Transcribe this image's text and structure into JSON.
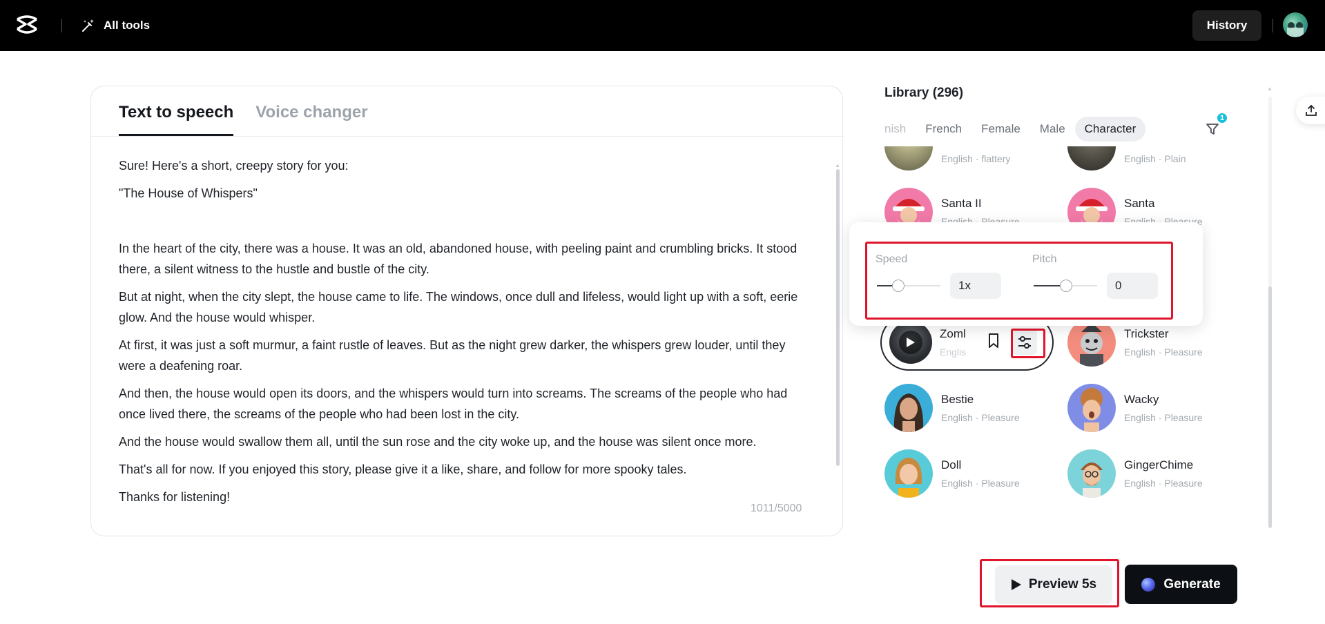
{
  "topbar": {
    "all_tools_label": "All tools",
    "history_label": "History"
  },
  "editor": {
    "tabs": [
      {
        "label": "Text to speech",
        "active": true
      },
      {
        "label": "Voice changer",
        "active": false
      }
    ],
    "paragraphs": [
      "Sure! Here's a short, creepy story for you:",
      "\"The House of Whispers\"",
      "",
      "In the heart of the city, there was a house. It was an old, abandoned house, with peeling paint and crumbling bricks. It stood there, a silent witness to the hustle and bustle of the city.",
      "But at night, when the city slept, the house came to life. The windows, once dull and lifeless, would light up with a soft, eerie glow. And the house would whisper.",
      "At first, it was just a soft murmur, a faint rustle of leaves. But as the night grew darker, the whispers grew louder, until they were a deafening roar.",
      "And then, the house would open its doors, and the whispers would turn into screams. The screams of the people who had once lived there, the screams of the people who had been lost in the city.",
      "And the house would swallow them all, until the sun rose and the city woke up, and the house was silent once more.",
      "That's all for now. If you enjoyed this story, please give it a like, share, and follow for more spooky tales.",
      "Thanks for listening!"
    ],
    "char_count": "1011/5000"
  },
  "library": {
    "title": "Library (296)",
    "filters": [
      {
        "label": "nish",
        "active": false
      },
      {
        "label": "French",
        "active": false
      },
      {
        "label": "Female",
        "active": false
      },
      {
        "label": "Male",
        "active": false
      },
      {
        "label": "Character",
        "active": true
      }
    ],
    "filter_badge": "1",
    "top_partial": [
      {
        "meta": "English · flattery"
      },
      {
        "meta": "English · Plain"
      }
    ],
    "voices": [
      {
        "name": "Santa II",
        "meta": "English · Pleasure"
      },
      {
        "name": "Santa",
        "meta": "English · Pleasure"
      },
      {
        "name": "Zombie",
        "meta": "English · Pleasure"
      },
      {
        "name": "Trickster",
        "meta": "English · Pleasure"
      },
      {
        "name": "Bestie",
        "meta": "English · Pleasure"
      },
      {
        "name": "Wacky",
        "meta": "English · Pleasure"
      },
      {
        "name": "Doll",
        "meta": "English · Pleasure"
      },
      {
        "name": "GingerChime",
        "meta": "English · Pleasure"
      }
    ],
    "selected_name": "Zoml",
    "selected_meta": "Englis"
  },
  "settings": {
    "speed_label": "Speed",
    "speed_value": "1x",
    "pitch_label": "Pitch",
    "pitch_value": "0"
  },
  "actions": {
    "preview_label": "Preview 5s",
    "generate_label": "Generate"
  },
  "colors": {
    "accent_teal": "#19c1d8",
    "highlight_red": "#e0142b",
    "dark": "#0c0f14"
  }
}
